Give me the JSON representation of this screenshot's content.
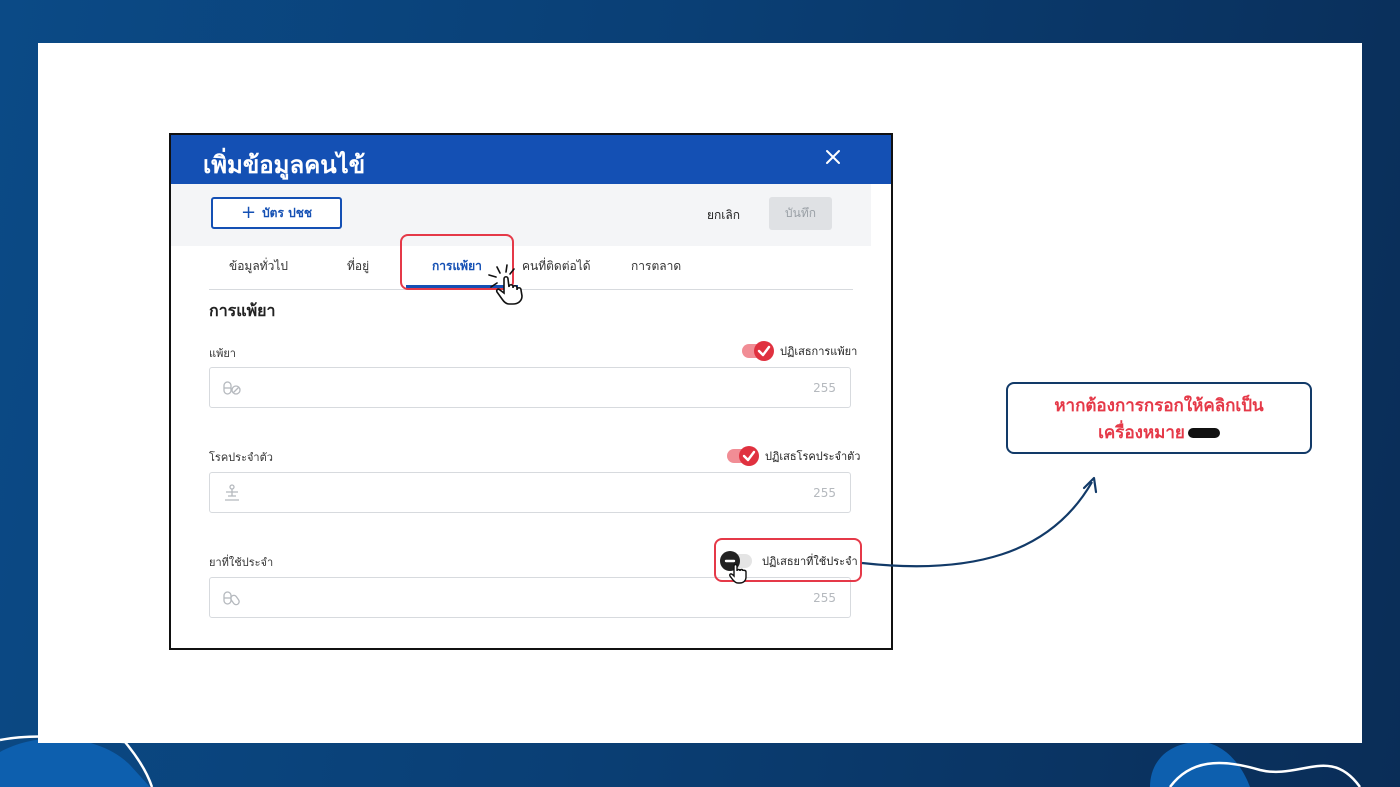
{
  "modal": {
    "title": "เพิ่มข้อมูลคนไข้",
    "id_card_button": "บัตร ปชช",
    "cancel_label": "ยกเลิก",
    "save_label": "บันทึก"
  },
  "tabs": [
    {
      "label": "ข้อมูลทั่วไป",
      "active": false
    },
    {
      "label": "ที่อยู่",
      "active": false
    },
    {
      "label": "การแพ้ยา",
      "active": true
    },
    {
      "label": "คนที่ติดต่อได้",
      "active": false
    },
    {
      "label": "การตลาด",
      "active": false
    }
  ],
  "section": {
    "title": "การแพ้ยา",
    "fields": [
      {
        "label": "แพ้ยา",
        "toggle_label": "ปฏิเสธการแพ้ยา",
        "toggle_on": true,
        "counter": "255",
        "icon": "pill-icon"
      },
      {
        "label": "โรคประจำตัว",
        "toggle_label": "ปฏิเสธโรคประจำตัว",
        "toggle_on": true,
        "counter": "255",
        "icon": "person-icon"
      },
      {
        "label": "ยาที่ใช้ประจำ",
        "toggle_label": "ปฏิเสธยาที่ใช้ประจำ",
        "toggle_on": false,
        "counter": "255",
        "icon": "medicine-icon"
      }
    ]
  },
  "callout": {
    "line1": "หากต้องการกรอกให้คลิกเป็น",
    "line2": "เครื่องหมาย"
  },
  "colors": {
    "primary": "#1450b4",
    "highlight": "#e53948",
    "toggle_on": "#e0313f",
    "background": "#0b4a86"
  }
}
